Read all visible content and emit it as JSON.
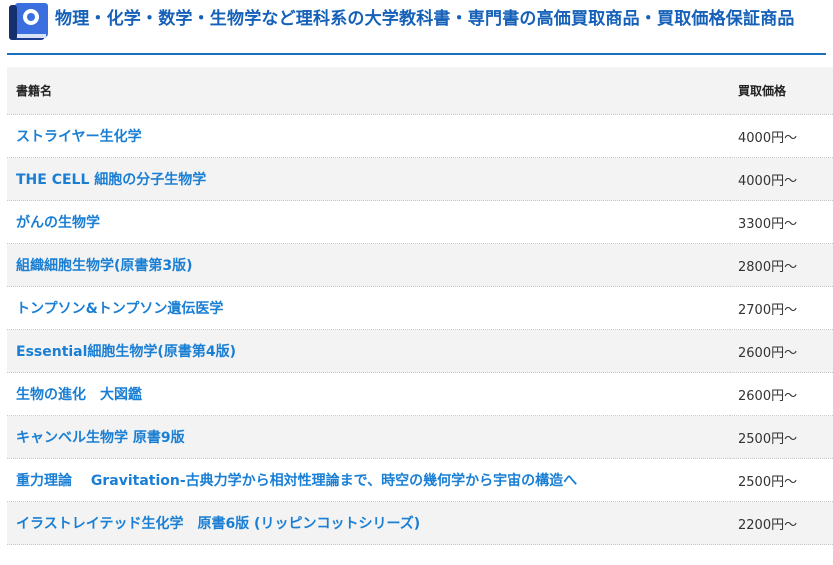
{
  "heading": {
    "icon": "book-icon",
    "title": "物理・化学・数学・生物学など理科系の大学教科書・専門書の高価買取商品・買取価格保証商品"
  },
  "table": {
    "columns": [
      "書籍名",
      "買取価格"
    ],
    "rows": [
      {
        "title": "ストライヤー生化学",
        "price": "4000円〜"
      },
      {
        "title": "THE CELL 細胞の分子生物学",
        "price": "4000円〜"
      },
      {
        "title": "がんの生物学",
        "price": "3300円〜"
      },
      {
        "title": "組織細胞生物学(原書第3版)",
        "price": "2800円〜"
      },
      {
        "title": "トンプソン&トンプソン遺伝医学",
        "price": "2700円〜"
      },
      {
        "title": "Essential細胞生物学(原書第4版)",
        "price": "2600円〜"
      },
      {
        "title": "生物の進化　大図鑑",
        "price": "2600円〜"
      },
      {
        "title": "キャンベル生物学 原書9版",
        "price": "2500円〜"
      },
      {
        "title": "重力理論　 Gravitation-古典力学から相対性理論まで、時空の幾何学から宇宙の構造へ",
        "price": "2500円〜"
      },
      {
        "title": "イラストレイテッド生化学　原書6版 (リッピンコットシリーズ)",
        "price": "2200円〜"
      }
    ]
  },
  "colors": {
    "accent": "#1a6fbf",
    "link": "#1a7fd4",
    "row_alt": "#f3f3f3"
  }
}
